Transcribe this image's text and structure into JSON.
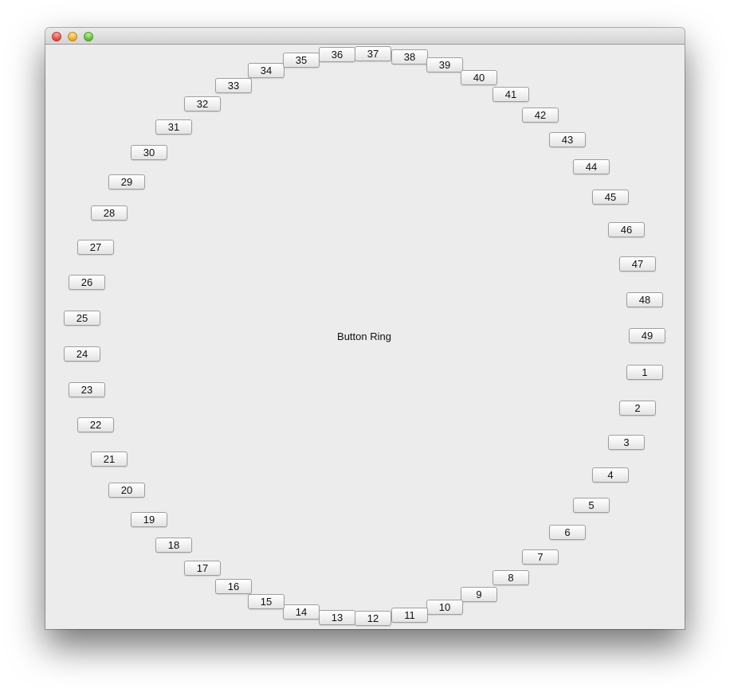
{
  "window": {
    "center_label": "Button Ring"
  },
  "ring": {
    "buttons": [
      "1",
      "2",
      "3",
      "4",
      "5",
      "6",
      "7",
      "8",
      "9",
      "10",
      "11",
      "12",
      "13",
      "14",
      "15",
      "16",
      "17",
      "18",
      "19",
      "20",
      "21",
      "22",
      "23",
      "24",
      "25",
      "26",
      "27",
      "28",
      "29",
      "30",
      "31",
      "32",
      "33",
      "34",
      "35",
      "36",
      "37",
      "38",
      "39",
      "40",
      "41",
      "42",
      "43",
      "44",
      "45",
      "46",
      "47",
      "48",
      "49"
    ]
  }
}
